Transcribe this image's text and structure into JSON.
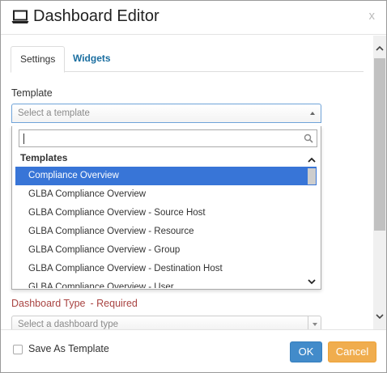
{
  "dialog": {
    "title": "Dashboard Editor",
    "close_glyph": "x",
    "title_icon": "laptop-icon"
  },
  "tabs": [
    {
      "label": "Settings",
      "active": true
    },
    {
      "label": "Widgets",
      "active": false
    }
  ],
  "template": {
    "label": "Template",
    "placeholder": "Select a template",
    "search_value": "",
    "group_label": "Templates",
    "options": [
      "Compliance Overview",
      "GLBA Compliance Overview",
      "GLBA Compliance Overview - Source Host",
      "GLBA Compliance Overview - Resource",
      "GLBA Compliance Overview - Group",
      "GLBA Compliance Overview - Destination Host",
      "GLBA Compliance Overview - User"
    ],
    "selected_index": 0
  },
  "dashboard_type": {
    "label": "Dashboard Type",
    "required_text": "- Required",
    "placeholder": "Select a dashboard type"
  },
  "footer": {
    "save_as_template_label": "Save As Template",
    "ok_label": "OK",
    "cancel_label": "Cancel"
  },
  "colors": {
    "accent": "#3875d7",
    "ok": "#428bca",
    "cancel": "#f0ad4e",
    "required": "#a94442",
    "link": "#1a6ea0"
  }
}
